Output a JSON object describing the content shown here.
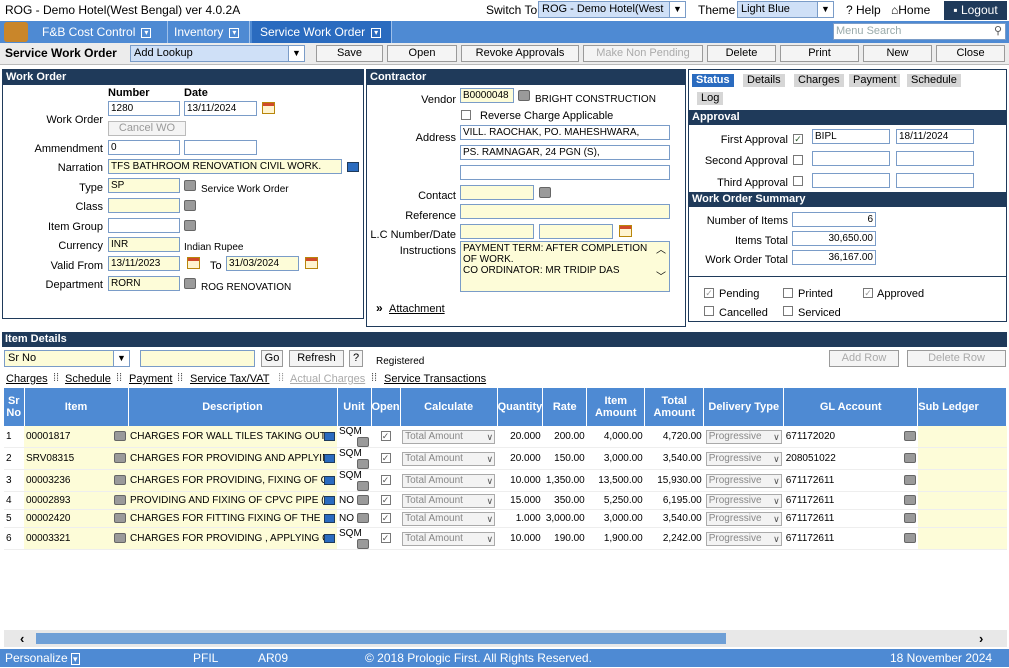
{
  "titlebar": {
    "title": "ROG - Demo Hotel(West Bengal) ver 4.0.2A",
    "switch_label": "Switch To",
    "switch_value": "ROG - Demo Hotel(West",
    "theme_label": "Theme",
    "theme_value": "Light Blue",
    "help": "Help",
    "home": "Home",
    "logout": "Logout"
  },
  "menu": {
    "items": [
      {
        "label": "F&B Cost Control"
      },
      {
        "label": "Inventory"
      },
      {
        "label": "Service Work Order"
      }
    ],
    "search_placeholder": "Menu Search"
  },
  "toolbar": {
    "title": "Service Work Order",
    "lookup_value": "Add Lookup",
    "buttons": [
      "Save",
      "Open",
      "Revoke Approvals",
      "Make Non Pending",
      "Delete",
      "Print",
      "New",
      "Close"
    ]
  },
  "work_order": {
    "header": "Work Order",
    "number_hdr": "Number",
    "date_hdr": "Date",
    "wo_label": "Work Order",
    "number": "1280",
    "date": "13/11/2024",
    "cancel_button": "Cancel WO",
    "ammendment_label": "Ammendment",
    "ammendment": "0",
    "narration_label": "Narration",
    "narration": "TFS BATHROOM RENOVATION CIVIL WORK.",
    "type_label": "Type",
    "type_code": "SP",
    "type_desc": "Service Work Order",
    "class_label": "Class",
    "item_group_label": "Item Group",
    "currency_label": "Currency",
    "currency": "INR",
    "currency_desc": "Indian Rupee",
    "valid_from_label": "Valid From",
    "valid_from": "13/11/2023",
    "to_label": "To",
    "valid_to": "31/03/2024",
    "department_label": "Department",
    "department": "RORN",
    "department_desc": "ROG RENOVATION"
  },
  "contractor": {
    "header": "Contractor",
    "vendor_label": "Vendor",
    "vendor_code": "B0000048",
    "vendor_name": "BRIGHT CONSTRUCTION",
    "reverse_charge": "Reverse Charge Applicable",
    "address_label": "Address",
    "address1": "VILL. RAOCHAK, PO. MAHESHWARA,",
    "address2": "PS. RAMNAGAR, 24 PGN (S),",
    "contact_label": "Contact",
    "reference_label": "Reference",
    "lc_label": "L.C Number/Date",
    "instructions_label": "Instructions",
    "instructions1": "PAYMENT TERM: AFTER COMPLETION",
    "instructions2": "OF WORK.",
    "instructions3": "CO ORDINATOR: MR TRIDIP DAS",
    "attachment": "Attachment"
  },
  "status": {
    "tabs": [
      "Status",
      "Details",
      "Charges",
      "Payment",
      "Schedule",
      "Log"
    ],
    "approval_header": "Approval",
    "first_label": "First Approval",
    "first_user": "BIPL",
    "first_date": "18/11/2024",
    "second_label": "Second Approval",
    "third_label": "Third Approval",
    "summary_header": "Work Order Summary",
    "num_items_label": "Number of Items",
    "num_items": "6",
    "items_total_label": "Items Total",
    "items_total": "30,650.00",
    "wo_total_label": "Work Order Total",
    "wo_total": "36,167.00",
    "flags": {
      "pending": "Pending",
      "printed": "Printed",
      "approved": "Approved",
      "cancelled": "Cancelled",
      "serviced": "Serviced"
    }
  },
  "items": {
    "header": "Item Details",
    "srno_select": "Sr No",
    "go": "Go",
    "refresh": "Refresh",
    "help": "?",
    "registered": "Registered",
    "add_row": "Add Row",
    "delete_row": "Delete Row",
    "links": [
      "Charges",
      "Schedule",
      "Payment",
      "Service Tax/VAT",
      "Actual Charges",
      "Service Transactions"
    ],
    "columns": [
      "Sr No",
      "Item",
      "Description",
      "Unit",
      "Open",
      "Calculate",
      "Quantity",
      "Rate",
      "Item Amount",
      "Total Amount",
      "Delivery Type",
      "GL Account",
      "Sub Ledger"
    ],
    "rows": [
      {
        "sr": "1",
        "item": "00001817",
        "desc": "CHARGES FOR WALL TILES TAKING OUT,",
        "unit": "SQM",
        "calc": "Total Amount",
        "qty": "20.000",
        "rate": "200.00",
        "amt": "4,000.00",
        "total": "4,720.00",
        "del": "Progressive",
        "gl": "671172020"
      },
      {
        "sr": "2",
        "item": "SRV08315",
        "desc": "CHARGES FOR PROVIDING AND APPLYIN",
        "unit": "SQM",
        "calc": "Total Amount",
        "qty": "20.000",
        "rate": "150.00",
        "amt": "3,000.00",
        "total": "3,540.00",
        "del": "Progressive",
        "gl": "208051022"
      },
      {
        "sr": "3",
        "item": "00003236",
        "desc": "CHARGES FOR PROVIDING, FIXING OF C",
        "unit": "SQM",
        "calc": "Total Amount",
        "qty": "10.000",
        "rate": "1,350.00",
        "amt": "13,500.00",
        "total": "15,930.00",
        "del": "Progressive",
        "gl": "671172611"
      },
      {
        "sr": "4",
        "item": "00002893",
        "desc": "PROVIDING AND FIXING OF CPVC PIPE (",
        "unit": "NO",
        "calc": "Total Amount",
        "qty": "15.000",
        "rate": "350.00",
        "amt": "5,250.00",
        "total": "6,195.00",
        "del": "Progressive",
        "gl": "671172611"
      },
      {
        "sr": "5",
        "item": "00002420",
        "desc": "CHARGES FOR FITTING FIXING OF THE",
        "unit": "NO",
        "calc": "Total Amount",
        "qty": "1.000",
        "rate": "3,000.00",
        "amt": "3,000.00",
        "total": "3,540.00",
        "del": "Progressive",
        "gl": "671172611"
      },
      {
        "sr": "6",
        "item": "00003321",
        "desc": "CHARGES FOR PROVIDING , APPLYING O",
        "unit": "SQM",
        "calc": "Total Amount",
        "qty": "10.000",
        "rate": "190.00",
        "amt": "1,900.00",
        "total": "2,242.00",
        "del": "Progressive",
        "gl": "671172611"
      }
    ]
  },
  "footer": {
    "personalize": "Personalize",
    "code1": "PFIL",
    "code2": "AR09",
    "copyright": "© 2018 Prologic First. All Rights Reserved.",
    "date": "18 November 2024"
  }
}
